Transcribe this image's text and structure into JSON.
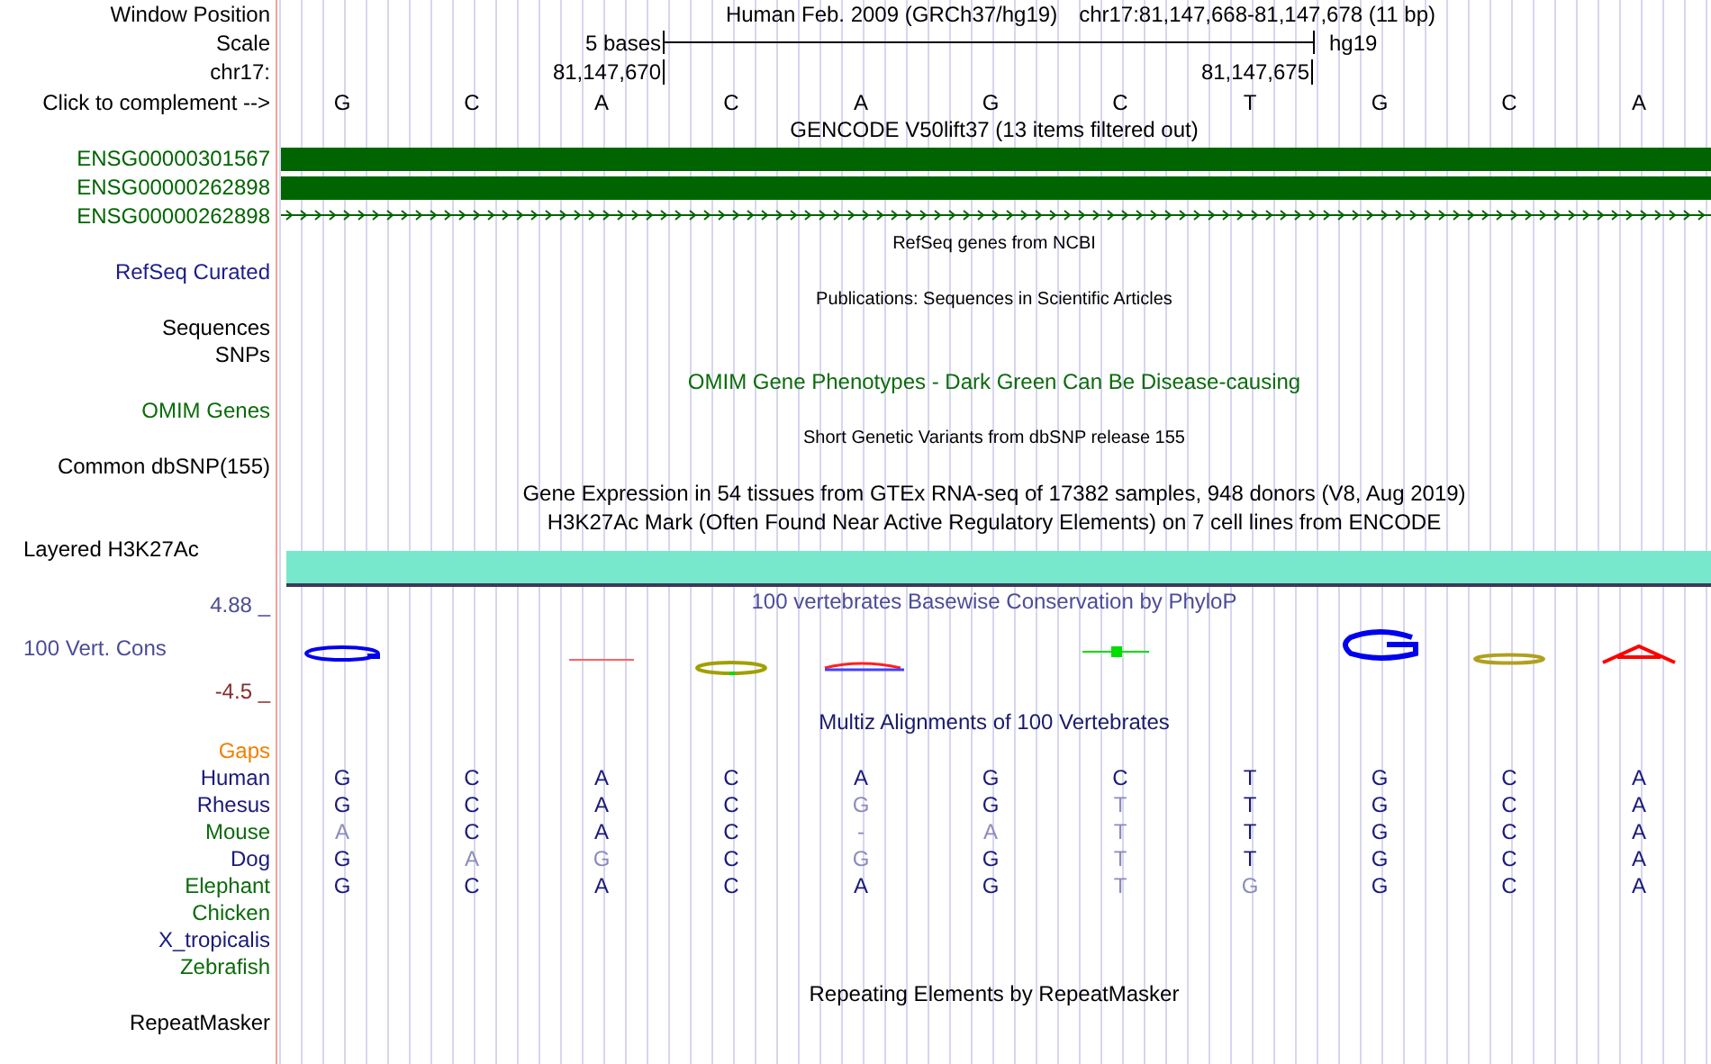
{
  "header": {
    "position_label": "Window Position",
    "assembly": "Human Feb. 2009 (GRCh37/hg19)",
    "position": "chr17:81,147,668-81,147,678 (11 bp)",
    "scale_label": "Scale",
    "scale_text": "5 bases",
    "scale_db": "hg19",
    "chrom_label": "chr17:",
    "coord_start": "81,147,670",
    "coord_end": "81,147,675",
    "complement_label": "Click to complement -->",
    "bases": [
      "G",
      "C",
      "A",
      "C",
      "A",
      "G",
      "C",
      "T",
      "G",
      "C",
      "A"
    ]
  },
  "tracks": [
    {
      "kind": "title",
      "text": "GENCODE V50lift37 (13 items filtered out)",
      "color": "#000000"
    },
    {
      "kind": "gene-bar",
      "label": "ENSG00000301567",
      "color": "#006400"
    },
    {
      "kind": "gene-bar",
      "label": "ENSG00000262898",
      "color": "#006400"
    },
    {
      "kind": "gene-line",
      "label": "ENSG00000262898",
      "color": "#006400"
    },
    {
      "kind": "small-title",
      "text": "RefSeq genes from NCBI",
      "color": "#000000"
    },
    {
      "kind": "label",
      "label": "RefSeq Curated",
      "color": "#1c1c8c"
    },
    {
      "kind": "small-title",
      "text": "Publications: Sequences in Scientific Articles",
      "color": "#000000"
    },
    {
      "kind": "label",
      "label": "Sequences",
      "color": "#000000"
    },
    {
      "kind": "label",
      "label": "SNPs",
      "color": "#000000"
    },
    {
      "kind": "title",
      "text": "OMIM Gene Phenotypes - Dark Green Can Be Disease-causing",
      "color": "#0b6b0b"
    },
    {
      "kind": "label",
      "label": "OMIM Genes",
      "color": "#0b6b0b"
    },
    {
      "kind": "small-title",
      "text": "Short Genetic Variants from dbSNP release 155",
      "color": "#000000"
    },
    {
      "kind": "label",
      "label": "Common dbSNP(155)",
      "color": "#000000"
    },
    {
      "kind": "title",
      "text": "Gene Expression in 54 tissues from GTEx RNA-seq of 17382 samples, 948 donors (V8, Aug 2019)",
      "color": "#000000"
    },
    {
      "kind": "title",
      "text": "H3K27Ac Mark (Often Found Near Active Regulatory Elements) on 7 cell lines from ENCODE",
      "color": "#000000"
    },
    {
      "kind": "signal",
      "label": "Layered H3K27Ac",
      "color": "#000000"
    },
    {
      "kind": "conservation",
      "title": "100 vertebrates Basewise Conservation by PhyloP",
      "label": "100 Vert. Cons",
      "max": "4.88 _",
      "min": "-4.5 _",
      "color": "#4c4c96"
    },
    {
      "kind": "title",
      "text": "Multiz Alignments of 100 Vertebrates",
      "color": "#1a1a6a"
    },
    {
      "kind": "label",
      "label": "Gaps",
      "color": "#f08000"
    },
    {
      "kind": "alignment",
      "label": "Human",
      "color": "#1a1a7a",
      "bases": [
        {
          "base": "G",
          "dim": false
        },
        {
          "base": "C",
          "dim": false
        },
        {
          "base": "A",
          "dim": false
        },
        {
          "base": "C",
          "dim": false
        },
        {
          "base": "A",
          "dim": false
        },
        {
          "base": "G",
          "dim": false
        },
        {
          "base": "C",
          "dim": false
        },
        {
          "base": "T",
          "dim": false
        },
        {
          "base": "G",
          "dim": false
        },
        {
          "base": "C",
          "dim": false
        },
        {
          "base": "A",
          "dim": false
        }
      ]
    },
    {
      "kind": "alignment",
      "label": "Rhesus",
      "color": "#1a1a7a",
      "bases": [
        {
          "base": "G",
          "dim": false
        },
        {
          "base": "C",
          "dim": false
        },
        {
          "base": "A",
          "dim": false
        },
        {
          "base": "C",
          "dim": false
        },
        {
          "base": "G",
          "dim": true
        },
        {
          "base": "G",
          "dim": false
        },
        {
          "base": "T",
          "dim": true
        },
        {
          "base": "T",
          "dim": false
        },
        {
          "base": "G",
          "dim": false
        },
        {
          "base": "C",
          "dim": false
        },
        {
          "base": "A",
          "dim": false
        }
      ]
    },
    {
      "kind": "alignment",
      "label": "Mouse",
      "color": "#0b6b0b",
      "bases": [
        {
          "base": "A",
          "dim": true
        },
        {
          "base": "C",
          "dim": false
        },
        {
          "base": "A",
          "dim": false
        },
        {
          "base": "C",
          "dim": false
        },
        {
          "base": "-",
          "dim": true
        },
        {
          "base": "A",
          "dim": true
        },
        {
          "base": "T",
          "dim": true
        },
        {
          "base": "T",
          "dim": false
        },
        {
          "base": "G",
          "dim": false
        },
        {
          "base": "C",
          "dim": false
        },
        {
          "base": "A",
          "dim": false
        }
      ]
    },
    {
      "kind": "alignment",
      "label": "Dog",
      "color": "#1a1a7a",
      "bases": [
        {
          "base": "G",
          "dim": false
        },
        {
          "base": "A",
          "dim": true
        },
        {
          "base": "G",
          "dim": true
        },
        {
          "base": "C",
          "dim": false
        },
        {
          "base": "G",
          "dim": true
        },
        {
          "base": "G",
          "dim": false
        },
        {
          "base": "T",
          "dim": true
        },
        {
          "base": "T",
          "dim": false
        },
        {
          "base": "G",
          "dim": false
        },
        {
          "base": "C",
          "dim": false
        },
        {
          "base": "A",
          "dim": false
        }
      ]
    },
    {
      "kind": "alignment",
      "label": "Elephant",
      "color": "#0b6b0b",
      "bases": [
        {
          "base": "G",
          "dim": false
        },
        {
          "base": "C",
          "dim": false
        },
        {
          "base": "A",
          "dim": false
        },
        {
          "base": "C",
          "dim": false
        },
        {
          "base": "A",
          "dim": false
        },
        {
          "base": "G",
          "dim": false
        },
        {
          "base": "T",
          "dim": true
        },
        {
          "base": "G",
          "dim": true
        },
        {
          "base": "G",
          "dim": false
        },
        {
          "base": "C",
          "dim": false
        },
        {
          "base": "A",
          "dim": false
        }
      ]
    },
    {
      "kind": "alignment",
      "label": "Chicken",
      "color": "#0b6b0b"
    },
    {
      "kind": "alignment",
      "label": "X_tropicalis",
      "color": "#1a1a7a"
    },
    {
      "kind": "alignment",
      "label": "Zebrafish",
      "color": "#0b6b0b"
    },
    {
      "kind": "title",
      "text": "Repeating Elements by RepeatMasker",
      "color": "#000000"
    },
    {
      "kind": "label",
      "label": "RepeatMasker",
      "color": "#000000"
    }
  ]
}
